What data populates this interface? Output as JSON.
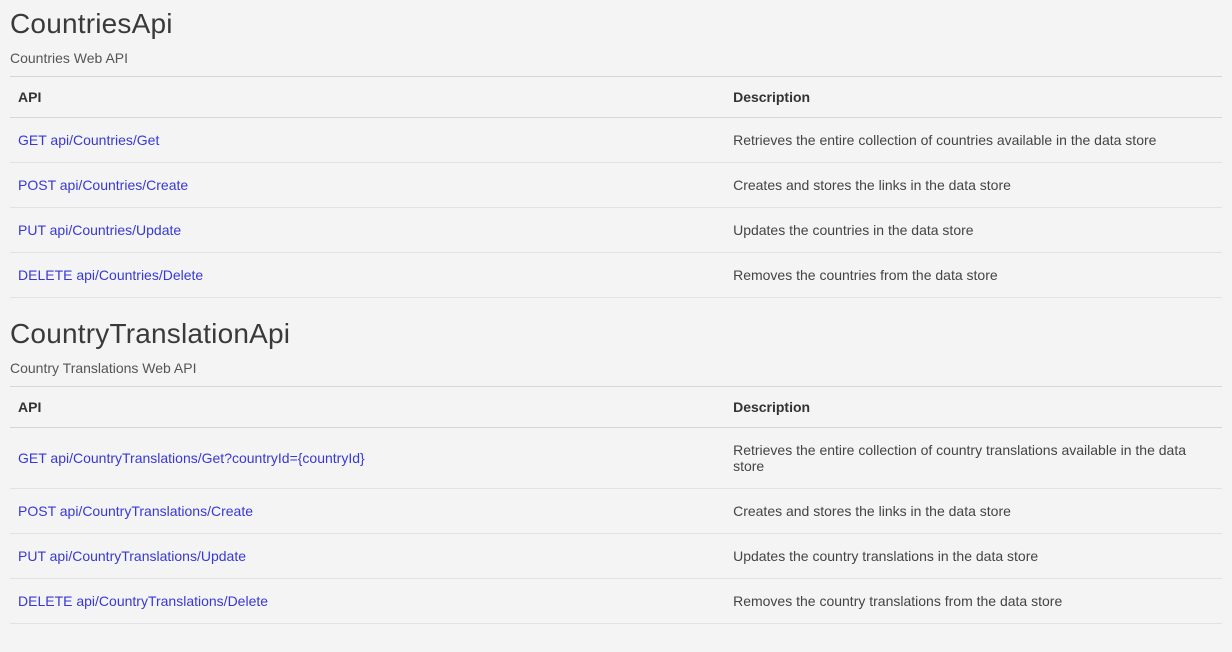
{
  "sections": [
    {
      "title": "CountriesApi",
      "subtitle": "Countries Web API",
      "headers": {
        "api": "API",
        "description": "Description"
      },
      "rows": [
        {
          "api": "GET api/Countries/Get",
          "description": "Retrieves the entire collection of countries available in the data store"
        },
        {
          "api": "POST api/Countries/Create",
          "description": "Creates and stores the links in the data store"
        },
        {
          "api": "PUT api/Countries/Update",
          "description": "Updates the countries in the data store"
        },
        {
          "api": "DELETE api/Countries/Delete",
          "description": "Removes the countries from the data store"
        }
      ]
    },
    {
      "title": "CountryTranslationApi",
      "subtitle": "Country Translations Web API",
      "headers": {
        "api": "API",
        "description": "Description"
      },
      "rows": [
        {
          "api": "GET api/CountryTranslations/Get?countryId={countryId}",
          "description": "Retrieves the entire collection of country translations available in the data store"
        },
        {
          "api": "POST api/CountryTranslations/Create",
          "description": "Creates and stores the links in the data store"
        },
        {
          "api": "PUT api/CountryTranslations/Update",
          "description": "Updates the country translations in the data store"
        },
        {
          "api": "DELETE api/CountryTranslations/Delete",
          "description": "Removes the country translations from the data store"
        }
      ]
    }
  ]
}
